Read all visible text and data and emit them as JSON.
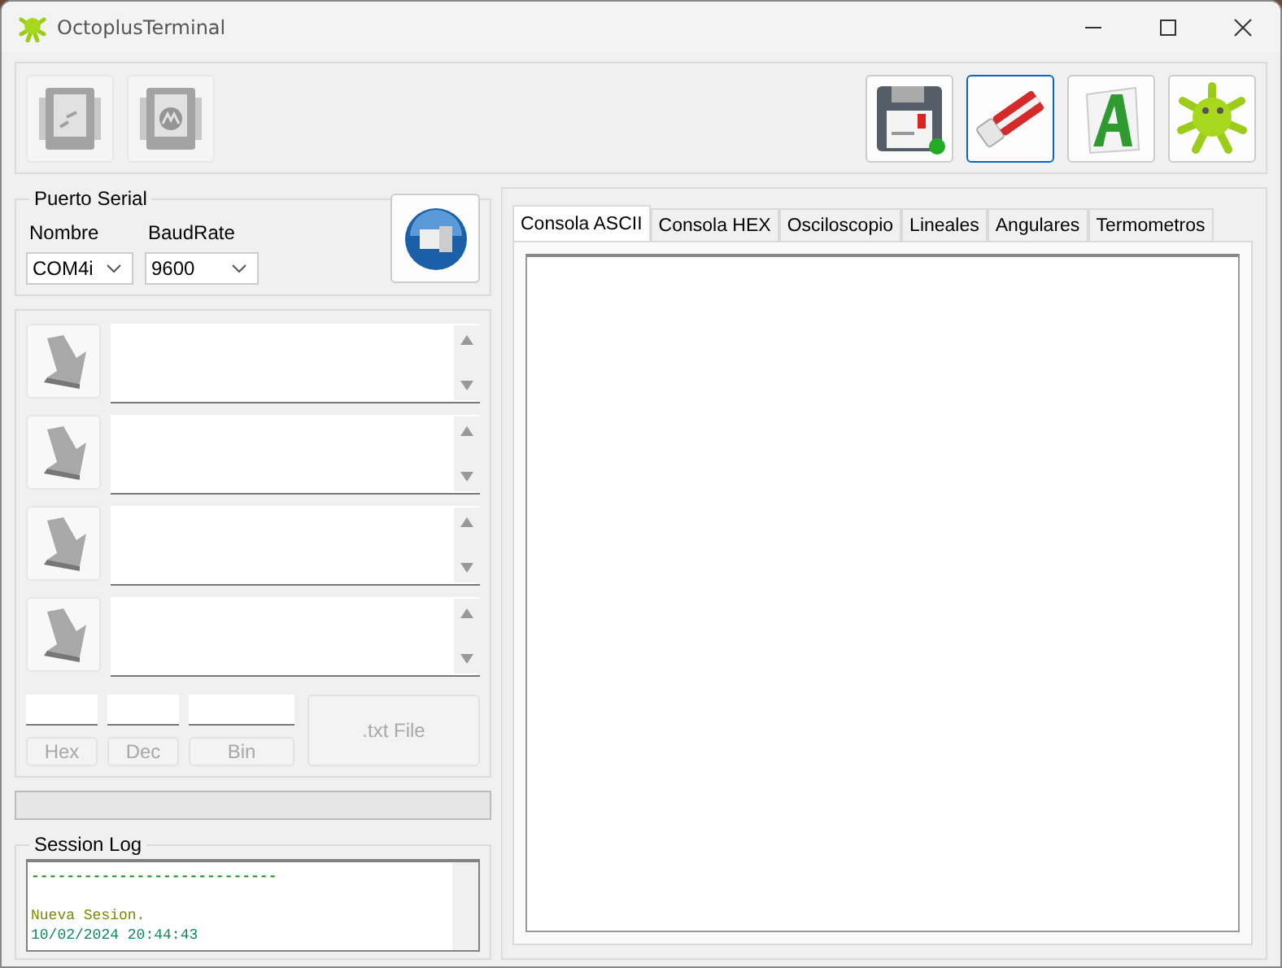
{
  "window": {
    "title": "OctoplusTerminal"
  },
  "toolbar": {
    "left_buttons": [
      {
        "kind": "chip-file",
        "disabled": true
      },
      {
        "kind": "chip-logo",
        "disabled": true
      }
    ],
    "right_buttons": [
      {
        "kind": "zip",
        "selected": false
      },
      {
        "kind": "eraser",
        "selected": true
      },
      {
        "kind": "font",
        "selected": false
      },
      {
        "kind": "octopus",
        "selected": false
      }
    ]
  },
  "serial_port": {
    "title": "Puerto Serial",
    "name_label": "Nombre",
    "name_value": "COM4i",
    "baud_label": "BaudRate",
    "baud_value": "9600"
  },
  "send_rows": [
    {
      "disabled": false
    },
    {
      "disabled": false
    },
    {
      "disabled": false
    },
    {
      "disabled": false
    }
  ],
  "converters": [
    {
      "label": "Hex",
      "disabled": true
    },
    {
      "label": "Dec",
      "disabled": true
    },
    {
      "label": "Bin",
      "disabled": true
    }
  ],
  "txt_file_button": {
    "label": ".txt File",
    "disabled": true
  },
  "progress": {
    "level": 0
  },
  "session_log": {
    "title": "Session Log",
    "lines": [
      {
        "text": "----------------------------",
        "color": "#1a9a1a"
      },
      {
        "text": "Nueva Sesion.",
        "color": "#7a8a00"
      },
      {
        "text": "10/02/2024 20:44:43",
        "color": "#0a8a5a"
      }
    ]
  },
  "tabs": [
    {
      "label": "Consola ASCII",
      "selected": true
    },
    {
      "label": "Consola HEX",
      "selected": false
    },
    {
      "label": "Osciloscopio",
      "selected": false
    },
    {
      "label": "Lineales",
      "selected": false
    },
    {
      "label": "Angulares",
      "selected": false
    },
    {
      "label": "Termometros",
      "selected": false
    }
  ]
}
